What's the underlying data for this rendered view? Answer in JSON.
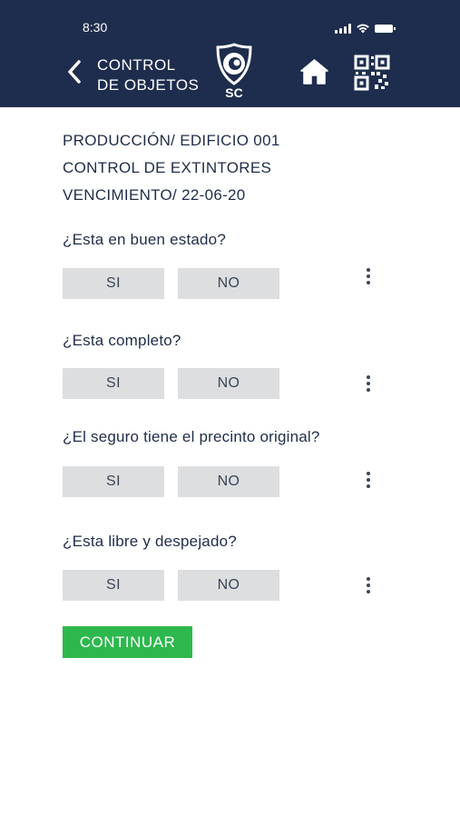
{
  "status_bar": {
    "time": "8:30"
  },
  "header": {
    "title_line1": "CONTROL",
    "title_line2": "DE OBJETOS",
    "logo_text": "SC",
    "back_icon": "chevron-left-icon",
    "home_icon": "home-icon",
    "qr_icon": "qr-scan-icon"
  },
  "info": {
    "line1": "PRODUCCIÓN/ EDIFICIO 001",
    "line2": "CONTROL DE EXTINTORES",
    "line3": "VENCIMIENTO/ 22-06-20"
  },
  "questions": [
    {
      "text": "¿Esta en buen estado?",
      "yes": "SI",
      "no": "NO"
    },
    {
      "text": "¿Esta completo?",
      "yes": "SI",
      "no": "NO"
    },
    {
      "text": "¿El seguro tiene el precinto original?",
      "yes": "SI",
      "no": "NO"
    },
    {
      "text": "¿Esta libre y despejado?",
      "yes": "SI",
      "no": "NO"
    }
  ],
  "continue_label": "CONTINUAR",
  "colors": {
    "header_bg": "#1e2d4d",
    "button_bg": "#dcdee0",
    "accent_green": "#2db84d",
    "text": "#1f2d48"
  }
}
